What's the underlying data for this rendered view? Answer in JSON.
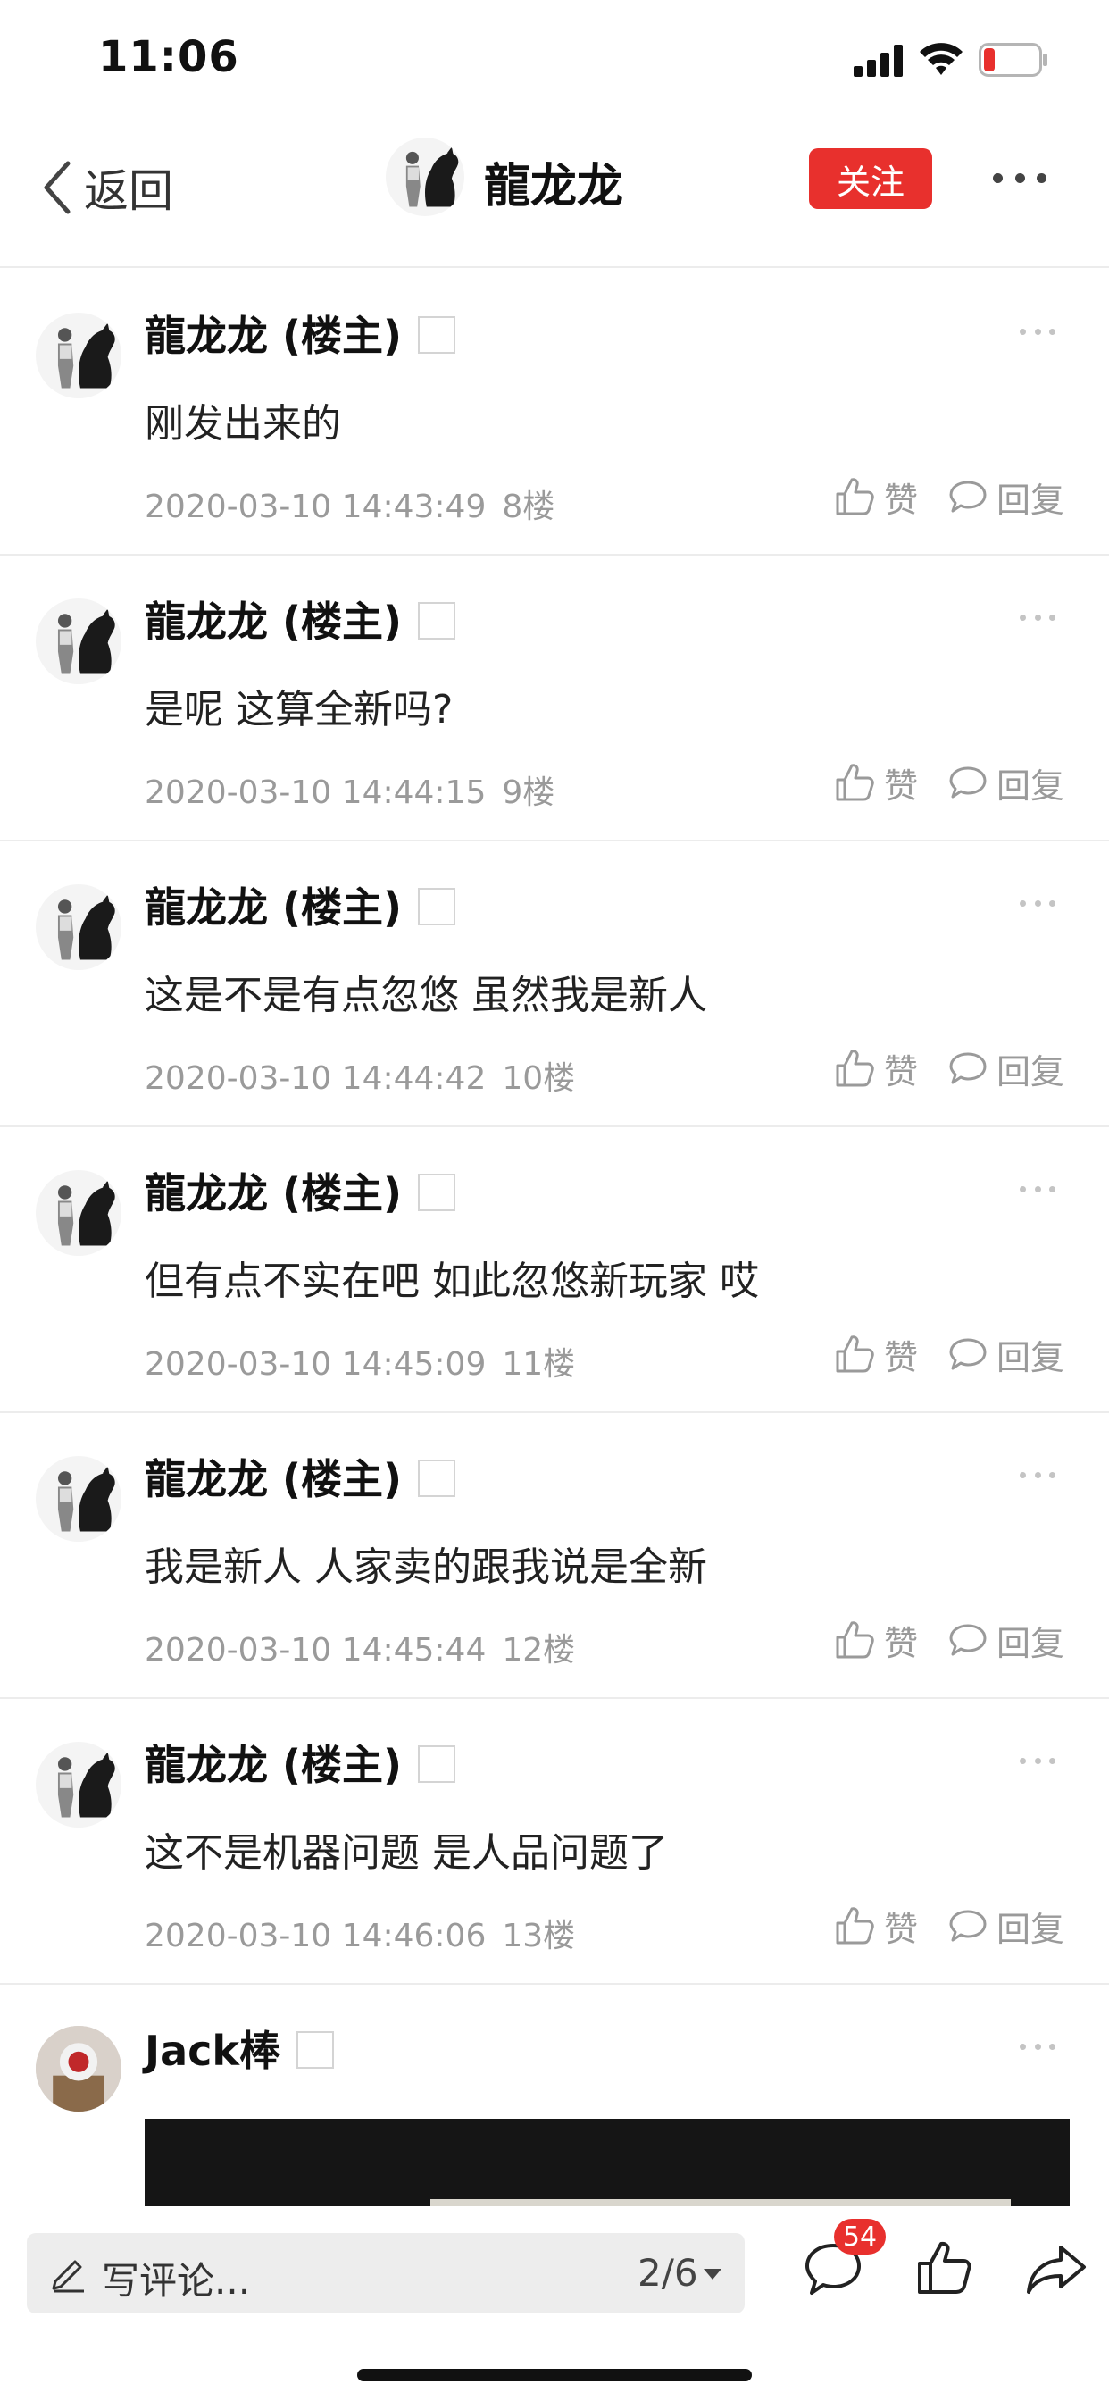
{
  "status_bar": {
    "time": "11:06"
  },
  "nav": {
    "back_label": "返回",
    "title": "龍龙龙",
    "follow_label": "关注"
  },
  "posts": [
    {
      "author": "龍龙龙 (楼主)",
      "content": "刚发出来的",
      "time": "2020-03-10 14:43:49",
      "floor": "8楼",
      "like_label": "赞",
      "reply_label": "回复"
    },
    {
      "author": "龍龙龙 (楼主)",
      "content": "是呢 这算全新吗?",
      "time": "2020-03-10 14:44:15",
      "floor": "9楼",
      "like_label": "赞",
      "reply_label": "回复"
    },
    {
      "author": "龍龙龙 (楼主)",
      "content": "这是不是有点忽悠 虽然我是新人",
      "time": "2020-03-10 14:44:42",
      "floor": "10楼",
      "like_label": "赞",
      "reply_label": "回复"
    },
    {
      "author": "龍龙龙 (楼主)",
      "content": "但有点不实在吧 如此忽悠新玩家 哎",
      "time": "2020-03-10 14:45:09",
      "floor": "11楼",
      "like_label": "赞",
      "reply_label": "回复"
    },
    {
      "author": "龍龙龙 (楼主)",
      "content": "我是新人 人家卖的跟我说是全新",
      "time": "2020-03-10 14:45:44",
      "floor": "12楼",
      "like_label": "赞",
      "reply_label": "回复"
    },
    {
      "author": "龍龙龙 (楼主)",
      "content": "这不是机器问题 是人品问题了",
      "time": "2020-03-10 14:46:06",
      "floor": "13楼",
      "like_label": "赞",
      "reply_label": "回复"
    }
  ],
  "last_post": {
    "author": "Jack棒"
  },
  "bottom_bar": {
    "comment_placeholder": "写评论...",
    "page_indicator": "2/6",
    "comment_count": "54"
  },
  "colors": {
    "accent": "#e8302d",
    "meta_text": "#9a9a9a",
    "divider": "#ececec"
  },
  "icons": [
    "back-chevron-icon",
    "more-icon",
    "thumbs-up-icon",
    "reply-bubble-icon",
    "pencil-icon",
    "comments-icon",
    "like-icon",
    "share-icon"
  ]
}
